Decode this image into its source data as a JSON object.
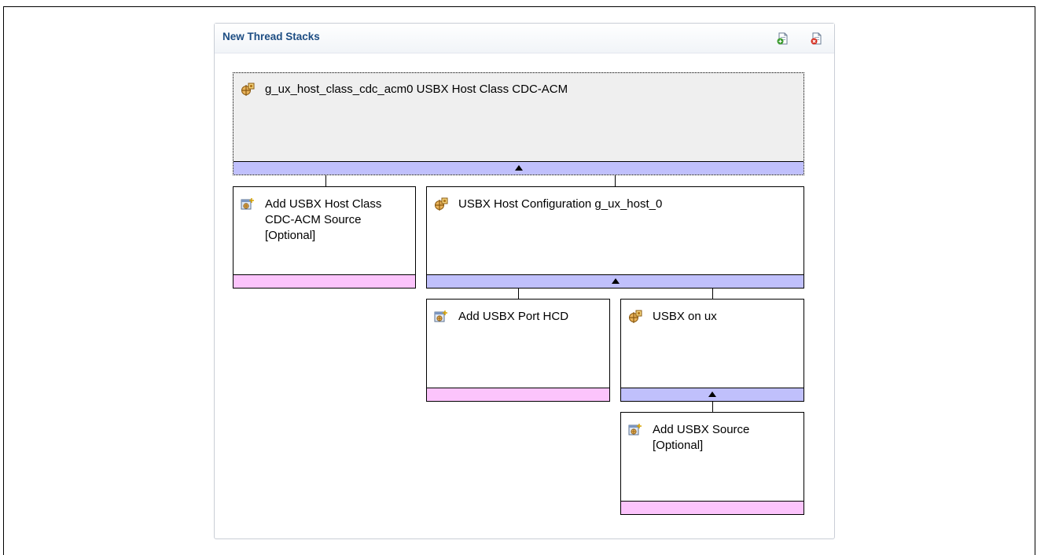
{
  "panel": {
    "title": "New Thread Stacks",
    "add_icon": "add-module-icon",
    "remove_icon": "remove-module-icon"
  },
  "modules": {
    "cdc_acm": {
      "label": "g_ux_host_class_cdc_acm0 USBX Host Class CDC-ACM",
      "icon": "module-instance-icon",
      "bar": "expandable"
    },
    "cdc_acm_source": {
      "label": "Add USBX Host Class\nCDC-ACM Source\n[Optional]",
      "icon": "add-module-icon",
      "bar": "optional"
    },
    "host_config": {
      "label": "USBX Host Configuration g_ux_host_0",
      "icon": "module-instance-icon",
      "bar": "expandable"
    },
    "port_hcd": {
      "label": "Add USBX Port HCD",
      "icon": "add-module-icon",
      "bar": "optional"
    },
    "usbx_on_ux": {
      "label": "USBX on ux",
      "icon": "module-instance-icon",
      "bar": "expandable"
    },
    "usbx_source": {
      "label": "Add USBX Source\n[Optional]",
      "icon": "add-module-icon",
      "bar": "optional"
    }
  },
  "colors": {
    "title": "#1d4d83",
    "bar_blue": "#c0c0fc",
    "bar_pink": "#fcc4fc",
    "selected_bg": "#efefef"
  }
}
